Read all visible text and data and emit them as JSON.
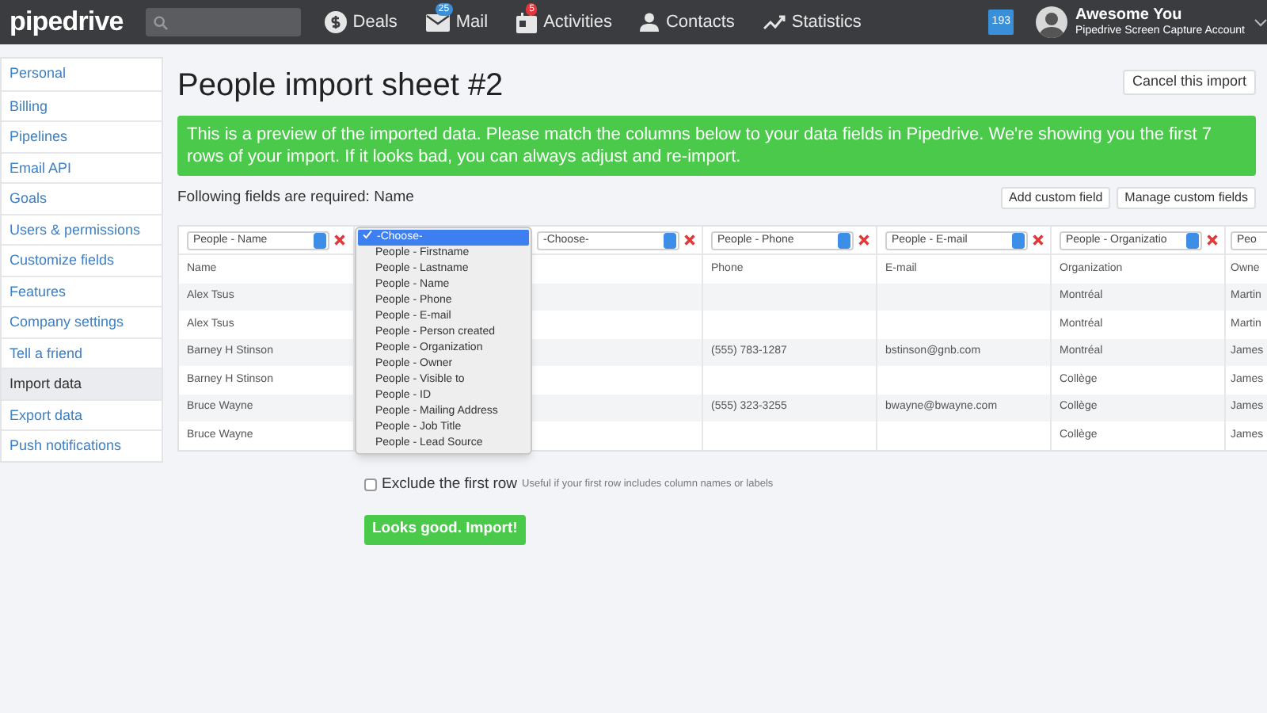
{
  "nav": {
    "logo": "pipedrive",
    "items": [
      {
        "label": "Deals",
        "kind": "dollar"
      },
      {
        "label": "Mail",
        "kind": "mail",
        "badge": "25"
      },
      {
        "label": "Activities",
        "kind": "calendar",
        "badge": "5"
      },
      {
        "label": "Contacts",
        "kind": "person"
      },
      {
        "label": "Statistics",
        "kind": "chart"
      }
    ],
    "notifications": "193",
    "user": {
      "name": "Awesome You",
      "account": "Pipedrive Screen Capture Account"
    }
  },
  "sidebar": {
    "items": [
      {
        "label": "Personal",
        "selected": false
      },
      {
        "label": "Billing",
        "selected": false
      },
      {
        "label": "Pipelines",
        "selected": false
      },
      {
        "label": "Email API",
        "selected": false
      },
      {
        "label": "Goals",
        "selected": false
      },
      {
        "label": "Users & permissions",
        "selected": false
      },
      {
        "label": "Customize fields",
        "selected": false
      },
      {
        "label": "Features",
        "selected": false
      },
      {
        "label": "Company settings",
        "selected": false
      },
      {
        "label": "Tell a friend",
        "selected": false
      },
      {
        "label": "Import data",
        "selected": true
      },
      {
        "label": "Export data",
        "selected": false
      },
      {
        "label": "Push notifications",
        "selected": false
      }
    ]
  },
  "page": {
    "title": "People import sheet #2",
    "cancel_button": "Cancel this import",
    "banner": "This is a preview of the imported data. Please match the columns below to your data fields in Pipedrive. We're showing you the first 7 rows of your import. If it looks bad, you can always adjust and re-import.",
    "required_text": "Following fields are required: Name",
    "buttons": [
      "Add custom field",
      "Manage custom fields"
    ],
    "table": {
      "columns": [
        {
          "field": "People - Name",
          "removable": true,
          "open": false
        },
        {
          "open": true,
          "options": [
            {
              "label": "-Choose-",
              "selected": true
            },
            {
              "label": "People - Firstname",
              "selected": false
            },
            {
              "label": "People - Lastname",
              "selected": false
            },
            {
              "label": "People - Name",
              "selected": false
            },
            {
              "label": "People - Phone",
              "selected": false
            },
            {
              "label": "People - E-mail",
              "selected": false
            },
            {
              "label": "People - Person created",
              "selected": false
            },
            {
              "label": "People - Organization",
              "selected": false
            },
            {
              "label": "People - Owner",
              "selected": false
            },
            {
              "label": "People - Visible to",
              "selected": false
            },
            {
              "label": "People - ID",
              "selected": false
            },
            {
              "label": "People - Mailing Address",
              "selected": false
            },
            {
              "label": "People - Job Title",
              "selected": false
            },
            {
              "label": "People - Lead Source",
              "selected": false
            }
          ]
        },
        {
          "field": "-Choose-",
          "removable": true,
          "open": false
        },
        {
          "field": "People - Phone",
          "removable": true,
          "open": false
        },
        {
          "field": "People - E-mail",
          "removable": true,
          "open": false
        },
        {
          "field": "People - Organizatio",
          "removable": true,
          "open": false
        },
        {
          "field": "Peo",
          "removable": false,
          "open": false
        }
      ],
      "rows": [
        [
          "Name",
          null,
          null,
          "Phone",
          "E-mail",
          "Organization",
          "Owne"
        ],
        [
          "Alex Tsus",
          null,
          null,
          null,
          null,
          "Montréal",
          "Martin"
        ],
        [
          "Alex Tsus",
          null,
          null,
          null,
          null,
          "Montréal",
          "Martin"
        ],
        [
          "Barney H Stinson",
          null,
          null,
          "(555) 783-1287",
          "bstinson@gnb.com",
          "Montréal",
          "James"
        ],
        [
          "Barney H Stinson",
          null,
          null,
          null,
          null,
          "Collège",
          "James"
        ],
        [
          "Bruce Wayne",
          null,
          null,
          "(555) 323-3255",
          "bwayne@bwayne.com",
          "Collège",
          "James"
        ],
        [
          "Bruce Wayne",
          null,
          null,
          null,
          null,
          "Collège",
          "James"
        ]
      ]
    },
    "exclude": {
      "label": "Exclude the first row",
      "hint": "Useful if your first row includes column names or labels",
      "checked": false
    },
    "import_button": "Looks good. Import!"
  }
}
